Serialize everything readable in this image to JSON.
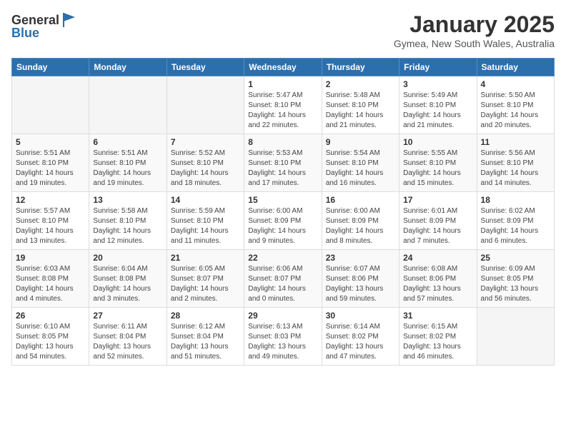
{
  "header": {
    "logo_line1": "General",
    "logo_line2": "Blue",
    "month_title": "January 2025",
    "location": "Gymea, New South Wales, Australia"
  },
  "days_of_week": [
    "Sunday",
    "Monday",
    "Tuesday",
    "Wednesday",
    "Thursday",
    "Friday",
    "Saturday"
  ],
  "weeks": [
    [
      {
        "day": "",
        "info": ""
      },
      {
        "day": "",
        "info": ""
      },
      {
        "day": "",
        "info": ""
      },
      {
        "day": "1",
        "info": "Sunrise: 5:47 AM\nSunset: 8:10 PM\nDaylight: 14 hours\nand 22 minutes."
      },
      {
        "day": "2",
        "info": "Sunrise: 5:48 AM\nSunset: 8:10 PM\nDaylight: 14 hours\nand 21 minutes."
      },
      {
        "day": "3",
        "info": "Sunrise: 5:49 AM\nSunset: 8:10 PM\nDaylight: 14 hours\nand 21 minutes."
      },
      {
        "day": "4",
        "info": "Sunrise: 5:50 AM\nSunset: 8:10 PM\nDaylight: 14 hours\nand 20 minutes."
      }
    ],
    [
      {
        "day": "5",
        "info": "Sunrise: 5:51 AM\nSunset: 8:10 PM\nDaylight: 14 hours\nand 19 minutes."
      },
      {
        "day": "6",
        "info": "Sunrise: 5:51 AM\nSunset: 8:10 PM\nDaylight: 14 hours\nand 19 minutes."
      },
      {
        "day": "7",
        "info": "Sunrise: 5:52 AM\nSunset: 8:10 PM\nDaylight: 14 hours\nand 18 minutes."
      },
      {
        "day": "8",
        "info": "Sunrise: 5:53 AM\nSunset: 8:10 PM\nDaylight: 14 hours\nand 17 minutes."
      },
      {
        "day": "9",
        "info": "Sunrise: 5:54 AM\nSunset: 8:10 PM\nDaylight: 14 hours\nand 16 minutes."
      },
      {
        "day": "10",
        "info": "Sunrise: 5:55 AM\nSunset: 8:10 PM\nDaylight: 14 hours\nand 15 minutes."
      },
      {
        "day": "11",
        "info": "Sunrise: 5:56 AM\nSunset: 8:10 PM\nDaylight: 14 hours\nand 14 minutes."
      }
    ],
    [
      {
        "day": "12",
        "info": "Sunrise: 5:57 AM\nSunset: 8:10 PM\nDaylight: 14 hours\nand 13 minutes."
      },
      {
        "day": "13",
        "info": "Sunrise: 5:58 AM\nSunset: 8:10 PM\nDaylight: 14 hours\nand 12 minutes."
      },
      {
        "day": "14",
        "info": "Sunrise: 5:59 AM\nSunset: 8:10 PM\nDaylight: 14 hours\nand 11 minutes."
      },
      {
        "day": "15",
        "info": "Sunrise: 6:00 AM\nSunset: 8:09 PM\nDaylight: 14 hours\nand 9 minutes."
      },
      {
        "day": "16",
        "info": "Sunrise: 6:00 AM\nSunset: 8:09 PM\nDaylight: 14 hours\nand 8 minutes."
      },
      {
        "day": "17",
        "info": "Sunrise: 6:01 AM\nSunset: 8:09 PM\nDaylight: 14 hours\nand 7 minutes."
      },
      {
        "day": "18",
        "info": "Sunrise: 6:02 AM\nSunset: 8:09 PM\nDaylight: 14 hours\nand 6 minutes."
      }
    ],
    [
      {
        "day": "19",
        "info": "Sunrise: 6:03 AM\nSunset: 8:08 PM\nDaylight: 14 hours\nand 4 minutes."
      },
      {
        "day": "20",
        "info": "Sunrise: 6:04 AM\nSunset: 8:08 PM\nDaylight: 14 hours\nand 3 minutes."
      },
      {
        "day": "21",
        "info": "Sunrise: 6:05 AM\nSunset: 8:07 PM\nDaylight: 14 hours\nand 2 minutes."
      },
      {
        "day": "22",
        "info": "Sunrise: 6:06 AM\nSunset: 8:07 PM\nDaylight: 14 hours\nand 0 minutes."
      },
      {
        "day": "23",
        "info": "Sunrise: 6:07 AM\nSunset: 8:06 PM\nDaylight: 13 hours\nand 59 minutes."
      },
      {
        "day": "24",
        "info": "Sunrise: 6:08 AM\nSunset: 8:06 PM\nDaylight: 13 hours\nand 57 minutes."
      },
      {
        "day": "25",
        "info": "Sunrise: 6:09 AM\nSunset: 8:05 PM\nDaylight: 13 hours\nand 56 minutes."
      }
    ],
    [
      {
        "day": "26",
        "info": "Sunrise: 6:10 AM\nSunset: 8:05 PM\nDaylight: 13 hours\nand 54 minutes."
      },
      {
        "day": "27",
        "info": "Sunrise: 6:11 AM\nSunset: 8:04 PM\nDaylight: 13 hours\nand 52 minutes."
      },
      {
        "day": "28",
        "info": "Sunrise: 6:12 AM\nSunset: 8:04 PM\nDaylight: 13 hours\nand 51 minutes."
      },
      {
        "day": "29",
        "info": "Sunrise: 6:13 AM\nSunset: 8:03 PM\nDaylight: 13 hours\nand 49 minutes."
      },
      {
        "day": "30",
        "info": "Sunrise: 6:14 AM\nSunset: 8:02 PM\nDaylight: 13 hours\nand 47 minutes."
      },
      {
        "day": "31",
        "info": "Sunrise: 6:15 AM\nSunset: 8:02 PM\nDaylight: 13 hours\nand 46 minutes."
      },
      {
        "day": "",
        "info": ""
      }
    ]
  ]
}
